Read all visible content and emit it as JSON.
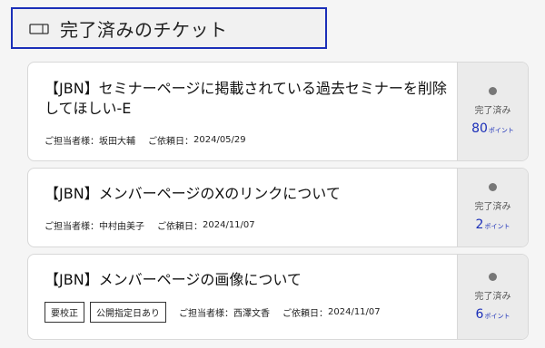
{
  "header": {
    "title": "完了済みのチケット",
    "icon": "ticket-icon"
  },
  "colors": {
    "accent": "#1b2fb8",
    "side_bg": "#ebebeb",
    "status_dot": "#777777"
  },
  "tickets": [
    {
      "title": "【JBN】セミナーページに掲載されている過去セミナーを削除してほしい-E",
      "assignee_label": "ご担当者様：",
      "assignee": "坂田大輔",
      "request_date_label": "ご依頼日：",
      "request_date": "2024/05/29",
      "tags": [],
      "status": "完了済み",
      "points": "80",
      "points_unit": "ポイント"
    },
    {
      "title": "【JBN】メンバーページのXのリンクについて",
      "assignee_label": "ご担当者様：",
      "assignee": "中村由美子",
      "request_date_label": "ご依頼日：",
      "request_date": "2024/11/07",
      "tags": [],
      "status": "完了済み",
      "points": "2",
      "points_unit": "ポイント"
    },
    {
      "title": "【JBN】メンバーページの画像について",
      "assignee_label": "ご担当者様：",
      "assignee": "西澤文香",
      "request_date_label": "ご依頼日：",
      "request_date": "2024/11/07",
      "tags": [
        "要校正",
        "公開指定日あり"
      ],
      "status": "完了済み",
      "points": "6",
      "points_unit": "ポイント"
    }
  ]
}
